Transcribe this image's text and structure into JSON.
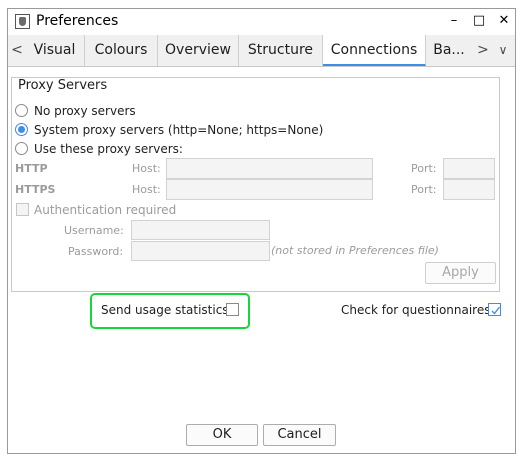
{
  "window": {
    "title": "Preferences",
    "minimize": "–",
    "maximize": "□",
    "close": "✕"
  },
  "tabs": {
    "prev_glyph": "<",
    "next_glyph": ">",
    "overflow_glyph": "∨",
    "items": [
      {
        "label": "Visual"
      },
      {
        "label": "Colours"
      },
      {
        "label": "Overview"
      },
      {
        "label": "Structure"
      },
      {
        "label": "Connections",
        "active": true
      },
      {
        "label": "Ba..."
      }
    ]
  },
  "proxy": {
    "legend": "Proxy Servers",
    "options": [
      {
        "label": "No proxy servers",
        "selected": false
      },
      {
        "label": "System proxy servers (http=None; https=None)",
        "selected": true
      },
      {
        "label": "Use these proxy servers:",
        "selected": false
      }
    ],
    "http_label": "HTTP",
    "https_label": "HTTPS",
    "host_label": "Host:",
    "port_label": "Port:",
    "http_host": "",
    "http_port": "",
    "https_host": "",
    "https_port": "",
    "auth_label": "Authentication required",
    "auth_checked": false,
    "username_label": "Username:",
    "password_label": "Password:",
    "username": "",
    "password": "",
    "password_note": "(not stored in Preferences file)",
    "apply_label": "Apply"
  },
  "stats": {
    "send_usage_label": "Send usage statistics",
    "send_usage_checked": false,
    "questionnaires_label": "Check for questionnaires",
    "questionnaires_checked": true
  },
  "footer": {
    "ok_label": "OK",
    "cancel_label": "Cancel"
  },
  "colors": {
    "accent": "#3d8ee8",
    "highlight": "#19d43b"
  }
}
